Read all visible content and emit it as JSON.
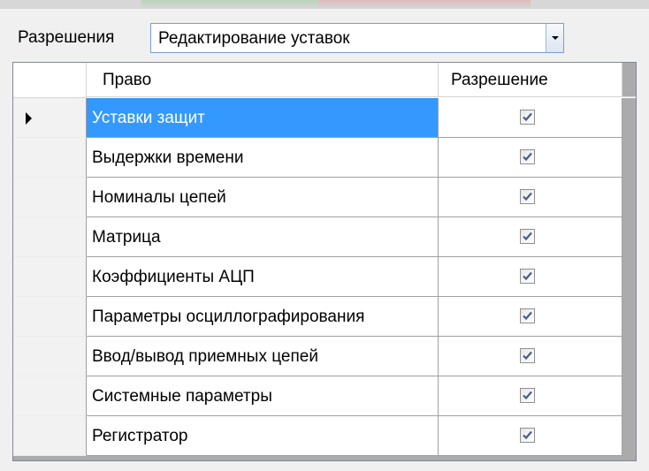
{
  "toolbar": {
    "permissions_label": "Разрешения",
    "combo_value": "Редактирование уставок",
    "combo_icon": "chevron-down-icon"
  },
  "grid": {
    "columns": [
      "Право",
      "Разрешение"
    ],
    "selected_row": 0,
    "row_indicator_icon": "triangle-right-icon",
    "rows": [
      {
        "name": "Уставки защит",
        "allowed": true
      },
      {
        "name": "Выдержки времени",
        "allowed": true
      },
      {
        "name": "Номиналы цепей",
        "allowed": true
      },
      {
        "name": "Матрица",
        "allowed": true
      },
      {
        "name": "Коэффициенты АЦП",
        "allowed": true
      },
      {
        "name": "Параметры осциллографирования",
        "allowed": true
      },
      {
        "name": "Ввод/вывод приемных цепей",
        "allowed": true
      },
      {
        "name": "Системные параметры",
        "allowed": true
      },
      {
        "name": "Регистратор",
        "allowed": true
      }
    ]
  },
  "colors": {
    "selection": "#3399ff",
    "grid_background": "#ababab",
    "checkmark": "#4a5a8a"
  }
}
